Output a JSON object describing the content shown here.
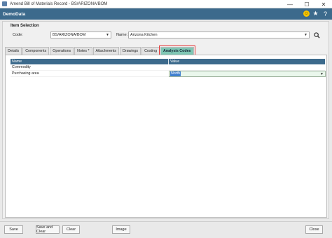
{
  "window": {
    "title": "Amend Bill of Materials Record - BS/ARIZONA/BOM",
    "minimize": "—",
    "maximize": "☐",
    "close": "✕"
  },
  "header": {
    "company": "DemoData",
    "icons": [
      "smiley-icon",
      "star-icon",
      "help-icon"
    ]
  },
  "item_selection": {
    "title": "Item Selection",
    "code_label": "Code:",
    "code_value": "BS/ARIZONA/BOM",
    "name_label": "Name:",
    "name_value": "Arizona Kitchen"
  },
  "tabs": [
    {
      "label": "Details"
    },
    {
      "label": "Components"
    },
    {
      "label": "Operations"
    },
    {
      "label": "Notes *"
    },
    {
      "label": "Attachments"
    },
    {
      "label": "Drawings"
    },
    {
      "label": "Costing"
    },
    {
      "label": "Analysis Codes",
      "active": true
    }
  ],
  "grid": {
    "headers": {
      "name": "Name",
      "value": "Value"
    },
    "rows": [
      {
        "name": "Commodity",
        "value": ""
      },
      {
        "name": "Purchasing area",
        "value": "North"
      }
    ]
  },
  "footer": {
    "save": "Save",
    "save_and_clear": "Save and Clear",
    "clear": "Clear",
    "image": "Image",
    "close": "Close"
  },
  "colors": {
    "accent": "#3c6a8c",
    "active_tab": "#7fc7b4",
    "highlight_outline": "#e23030"
  }
}
